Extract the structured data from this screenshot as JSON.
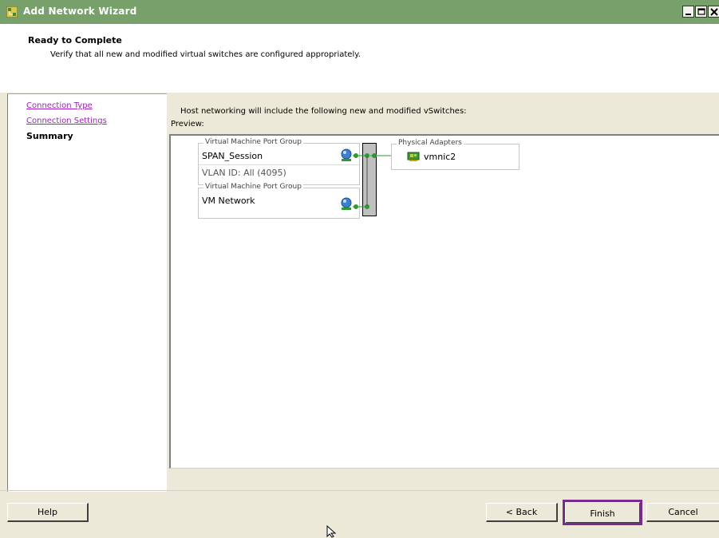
{
  "window": {
    "title": "Add Network Wizard",
    "icon": "network-wizard-icon",
    "controls": [
      "minimize-icon",
      "maximize-icon",
      "close-icon"
    ]
  },
  "header": {
    "title": "Ready to Complete",
    "subtitle": "Verify that all new and modified virtual switches are configured appropriately."
  },
  "nav": {
    "items": [
      {
        "label": "Connection Type",
        "state": "link"
      },
      {
        "label": "Connection Settings",
        "state": "link"
      },
      {
        "label": "Summary",
        "state": "current"
      }
    ],
    "link_color": "#a020c0"
  },
  "content": {
    "intro": "Host networking will include the following new and modified vSwitches:",
    "preview_label": "Preview:",
    "port_groups": [
      {
        "legend": "Virtual Machine Port Group",
        "name": "SPAN_Session",
        "vlan": "VLAN ID: All (4095)",
        "icon": "vm-portgroup-icon"
      },
      {
        "legend": "Virtual Machine Port Group",
        "name": "VM Network",
        "icon": "vm-portgroup-icon"
      }
    ],
    "physical_adapters": {
      "legend": "Physical Adapters",
      "items": [
        {
          "name": "vmnic2",
          "icon": "nic-icon"
        }
      ]
    }
  },
  "buttons": {
    "help": "Help",
    "back": "< Back",
    "finish": "Finish",
    "cancel": "Cancel"
  },
  "colors": {
    "titlebar": "#78a06a",
    "panel": "#ece9d8",
    "finish_highlight": "#7b2a8f",
    "connector_green": "#2e9a2e"
  }
}
